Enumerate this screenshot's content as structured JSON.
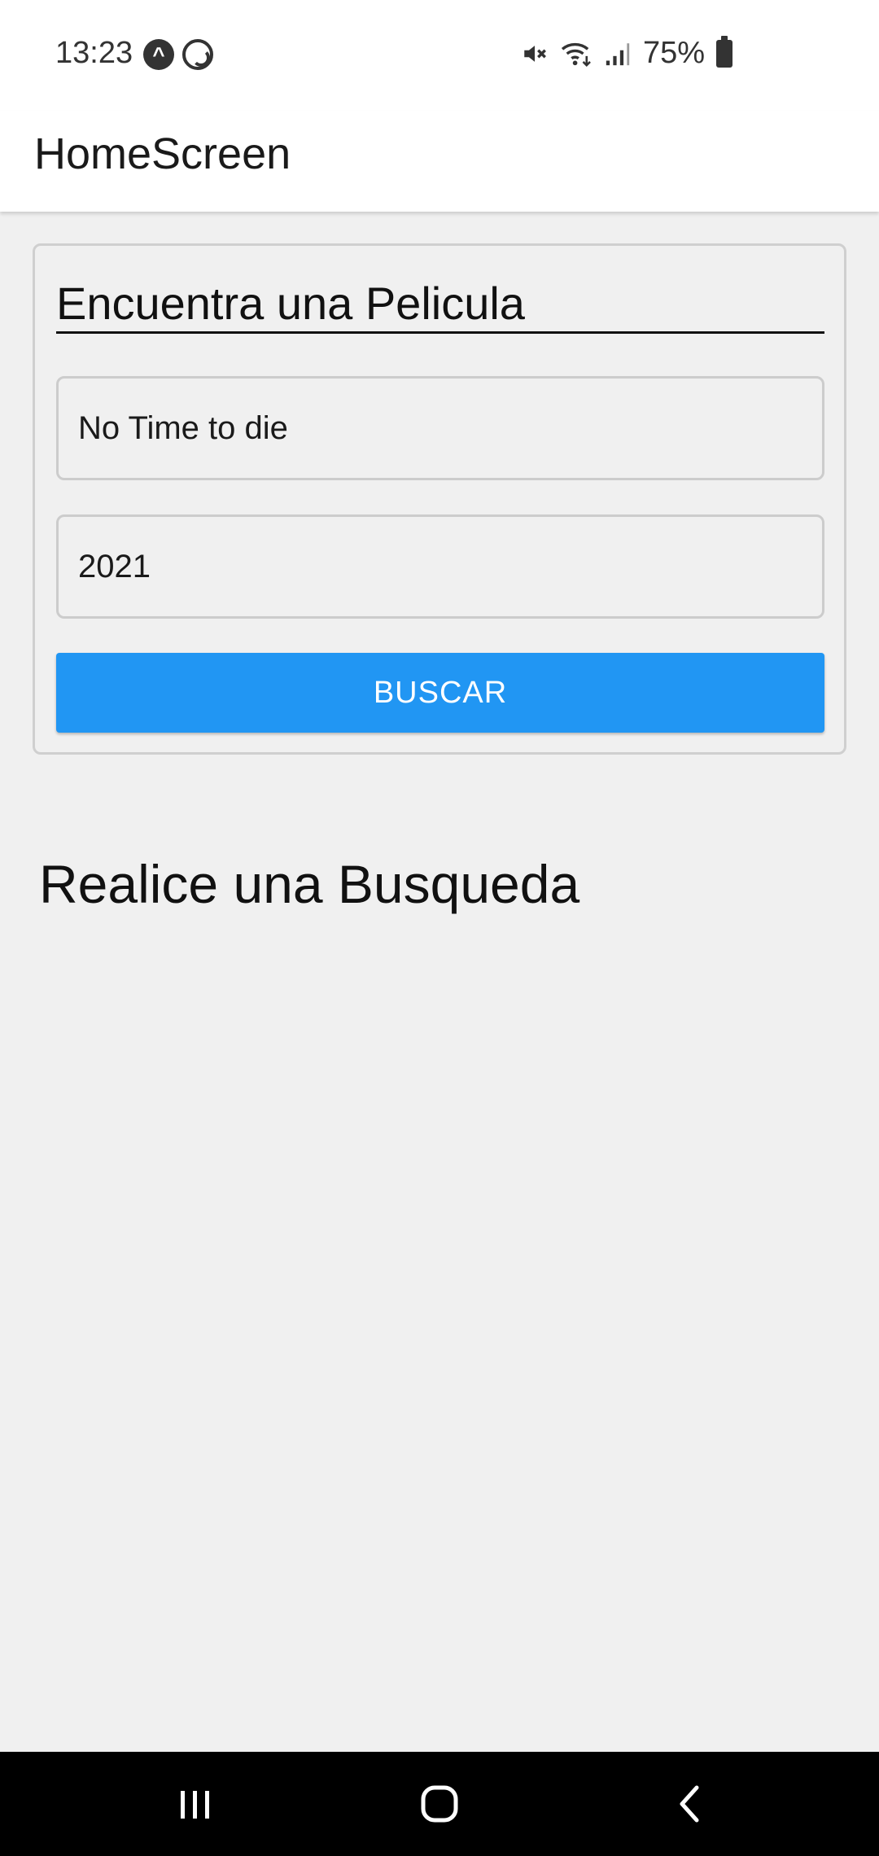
{
  "status_bar": {
    "time": "13:23",
    "battery": "75%",
    "icons": [
      "app-notification-icon",
      "whatsapp-icon",
      "mute-icon",
      "wifi-icon",
      "signal-icon",
      "battery-icon"
    ]
  },
  "app_bar": {
    "title": "HomeScreen"
  },
  "search_form": {
    "heading": "Encuentra una Pelicula",
    "title_input": {
      "value": "No Time to die"
    },
    "year_input": {
      "value": "2021"
    },
    "search_button_label": "BUSCAR"
  },
  "results": {
    "empty_message": "Realice una Busqueda"
  },
  "nav_bar": {
    "icons": [
      "recents-icon",
      "home-icon",
      "back-icon"
    ]
  },
  "colors": {
    "accent": "#2196f3",
    "background": "#f0f0f0",
    "nav_bar": "#000000"
  }
}
